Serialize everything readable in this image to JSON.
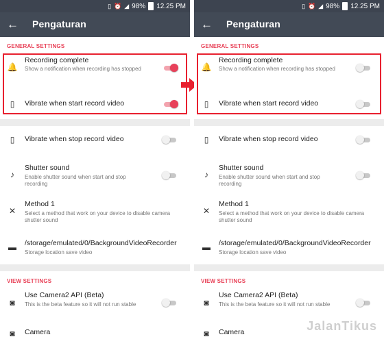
{
  "status": {
    "battery": "98%",
    "time": "12.25 PM"
  },
  "toolbar": {
    "title": "Pengaturan"
  },
  "sections": {
    "general": "GENERAL SETTINGS",
    "view": "VIEW SETTINGS"
  },
  "items": {
    "recording_complete": {
      "title": "Recording complete",
      "subtitle": "Show a notification when recording has stopped"
    },
    "vibrate_start": {
      "title": "Vibrate when start record video"
    },
    "vibrate_stop": {
      "title": "Vibrate when stop record video"
    },
    "shutter_sound": {
      "title": "Shutter sound",
      "subtitle": "Enable shutter sound when start and stop recording"
    },
    "method": {
      "title": "Method 1",
      "subtitle": "Select a method that work on your device to disable camera shutter sound"
    },
    "storage": {
      "title": "/storage/emulated/0/BackgroundVideoRecorder",
      "subtitle": "Storage location save video"
    },
    "camera2": {
      "title": "Use Camera2 API (Beta)",
      "subtitle": "This is the beta feature so it will not run stable"
    },
    "camera": {
      "title": "Camera"
    }
  },
  "toggle_states": {
    "left": {
      "recording_complete": true,
      "vibrate_start": true,
      "vibrate_stop": false,
      "shutter_sound": false,
      "camera2": false
    },
    "right": {
      "recording_complete": false,
      "vibrate_start": false,
      "vibrate_stop": false,
      "shutter_sound": false,
      "camera2": false
    }
  },
  "watermark": "JalanTikus",
  "icons": {
    "back": "arrow-left-icon",
    "bell": "bell-icon",
    "vibrate": "vibrate-icon",
    "music": "music-note-icon",
    "mute": "volume-off-icon",
    "folder": "folder-icon",
    "camera": "camera-icon"
  },
  "colors": {
    "accent": "#e84056",
    "toolbar": "#424a56",
    "statusbar": "#3d4450",
    "highlight": "#e8202f"
  }
}
